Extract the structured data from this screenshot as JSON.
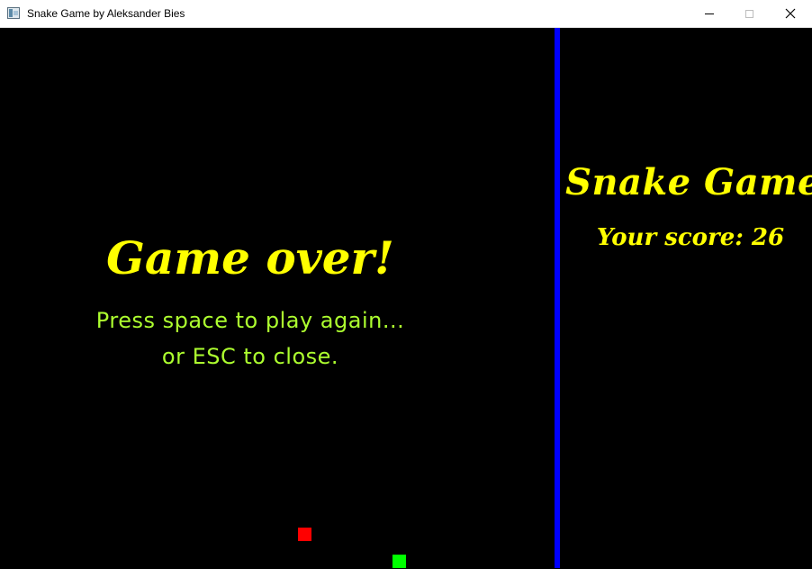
{
  "window": {
    "title": "Snake Game by Aleksander Bies",
    "icon": "app-window-icon",
    "controls": {
      "minimize_icon": "minimize-icon",
      "maximize_icon": "maximize-icon",
      "close_glyph": "✕"
    }
  },
  "game": {
    "game_over_title": "Game over!",
    "prompt_line_1": "Press space to play again...",
    "prompt_line_2": "or ESC to close.",
    "food_color": "#ff0000",
    "snake_color": "#00ff00",
    "divider_color": "#0000ff",
    "message_color": "#ffff00",
    "prompt_color": "#adff2f"
  },
  "side_panel": {
    "title": "Snake Game",
    "score_text": "Your score: 26"
  }
}
